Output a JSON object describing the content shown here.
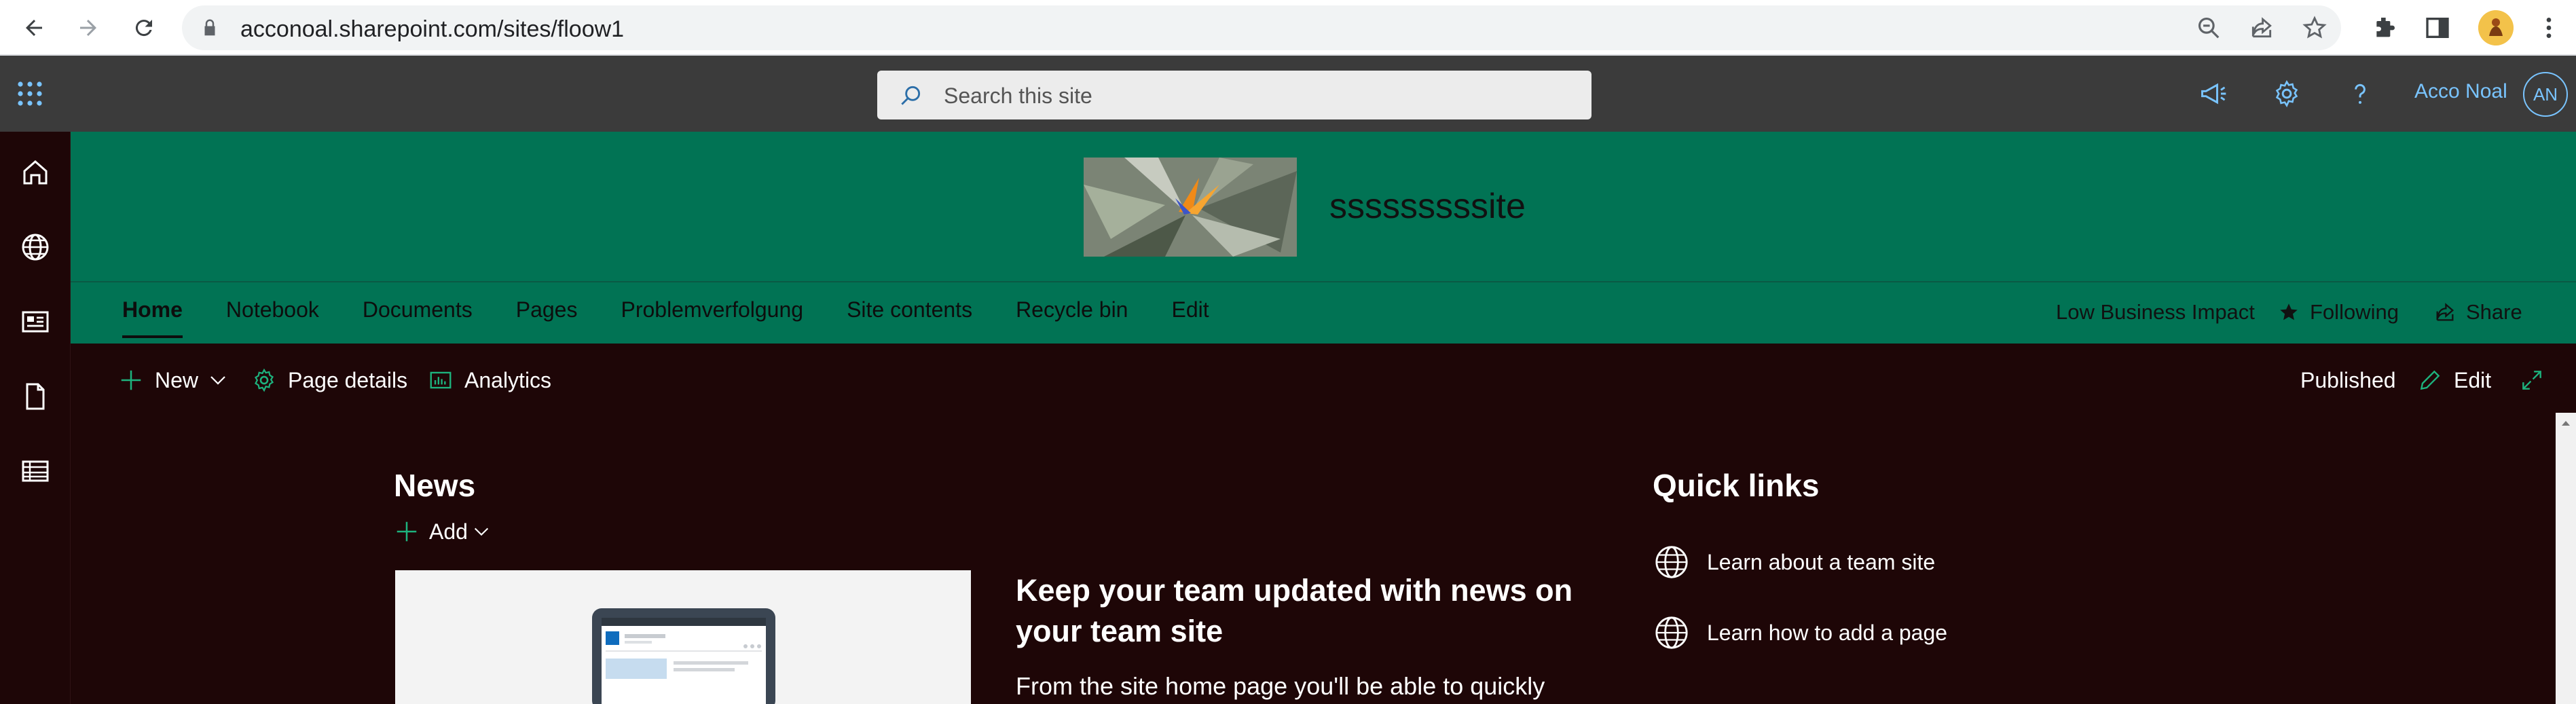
{
  "browser": {
    "url": "acconoal.sharepoint.com/sites/floow1"
  },
  "suite": {
    "search_placeholder": "Search this site",
    "user_name": "Acco Noal",
    "user_initials": "AN"
  },
  "site": {
    "title": "sssssssssite",
    "nav": [
      "Home",
      "Notebook",
      "Documents",
      "Pages",
      "Problemverfolgung",
      "Site contents",
      "Recycle bin",
      "Edit"
    ],
    "classification": "Low Business Impact",
    "following_label": "Following",
    "share_label": "Share"
  },
  "command_bar": {
    "new_label": "New",
    "page_details_label": "Page details",
    "analytics_label": "Analytics",
    "status": "Published",
    "edit_label": "Edit"
  },
  "news": {
    "title": "News",
    "add_label": "Add",
    "headline": "Keep your team updated with news on your team site",
    "body": "From the site home page you'll be able to quickly"
  },
  "quick_links": {
    "title": "Quick links",
    "items": [
      "Learn about a team site",
      "Learn how to add a page"
    ]
  },
  "colors": {
    "header_bg": "#017354",
    "page_bg": "#1e0607",
    "suitebar_bg": "#3b3b3b",
    "accent_link": "#79c4ff"
  }
}
